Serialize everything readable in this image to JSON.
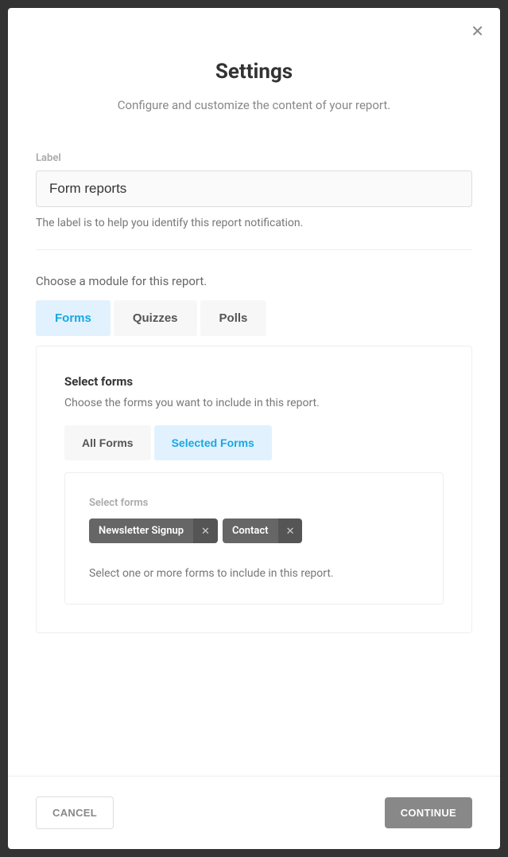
{
  "header": {
    "title": "Settings",
    "subtitle": "Configure and customize the content of your report."
  },
  "labelField": {
    "label": "Label",
    "value": "Form reports",
    "help": "The label is to help you identify this report notification."
  },
  "module": {
    "prompt": "Choose a module for this report.",
    "tabs": [
      "Forms",
      "Quizzes",
      "Polls"
    ]
  },
  "formsPanel": {
    "title": "Select forms",
    "desc": "Choose the forms you want to include in this report.",
    "subTabs": [
      "All Forms",
      "Selected Forms"
    ],
    "inner": {
      "label": "Select forms",
      "chips": [
        "Newsletter Signup",
        "Contact"
      ],
      "help": "Select one or more forms to include in this report."
    }
  },
  "footer": {
    "cancel": "CANCEL",
    "continue": "CONTINUE"
  }
}
